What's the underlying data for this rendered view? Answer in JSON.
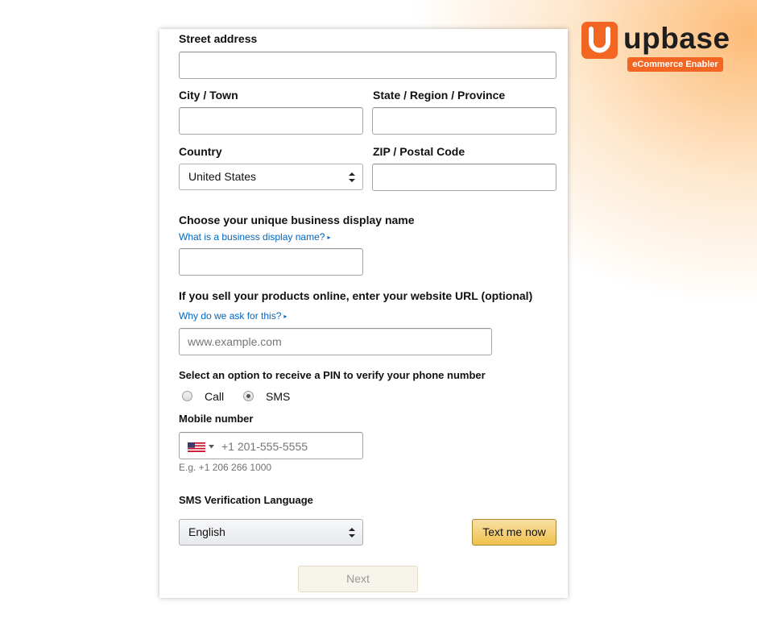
{
  "brand": {
    "name": "upbase",
    "tagline": "eCommerce Enabler",
    "color": "#f26522"
  },
  "form": {
    "street_address": {
      "label": "Street address",
      "value": ""
    },
    "city": {
      "label": "City / Town",
      "value": ""
    },
    "state": {
      "label": "State / Region / Province",
      "value": ""
    },
    "country": {
      "label": "Country",
      "selected": "United States"
    },
    "zip": {
      "label": "ZIP / Postal Code",
      "value": ""
    },
    "display_name": {
      "label": "Choose your unique business display name",
      "help_link": "What is a business display name?",
      "value": ""
    },
    "website": {
      "label": "If you sell your products online, enter your website URL (optional)",
      "help_link": "Why do we ask for this?",
      "placeholder": "www.example.com"
    },
    "pin_option": {
      "label": "Select an option to receive a PIN to verify your phone number",
      "options": [
        "Call",
        "SMS"
      ],
      "selected": "SMS"
    },
    "mobile": {
      "label": "Mobile number",
      "flag_icon": "us-flag-icon",
      "placeholder": "+1 201-555-5555",
      "example": "E.g. +1 206 266 1000"
    },
    "sms_language": {
      "label": "SMS Verification Language",
      "selected": "English"
    },
    "text_me_button": "Text me now",
    "next_button": "Next"
  },
  "colors": {
    "link": "#0066c0",
    "button_yellow": "#f0c14b",
    "disabled_button_bg": "#f7f4ec"
  }
}
